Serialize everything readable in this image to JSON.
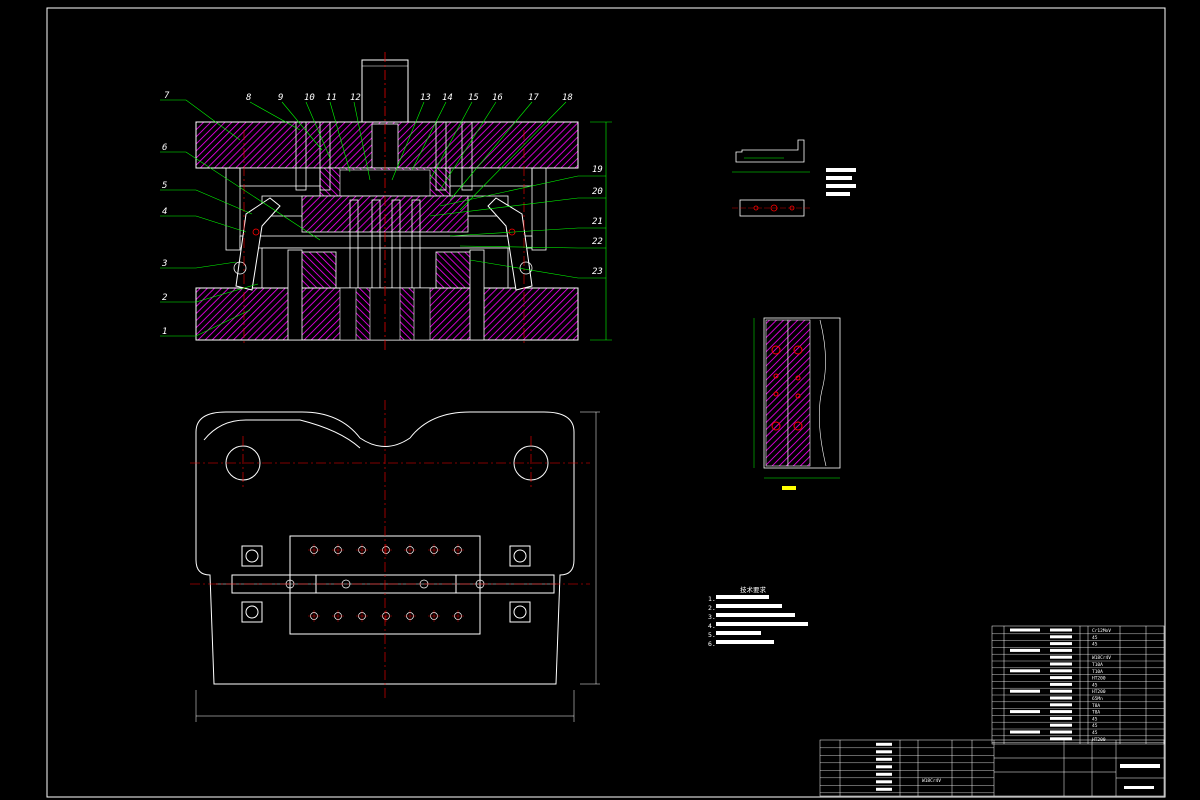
{
  "drawing": {
    "part_numbers": [
      "1",
      "2",
      "3",
      "4",
      "5",
      "6",
      "7",
      "8",
      "9",
      "10",
      "11",
      "12",
      "13",
      "14",
      "15",
      "16",
      "17",
      "18",
      "19",
      "20",
      "21",
      "22",
      "23"
    ],
    "tech_notes": [
      "技术要求",
      "1.",
      "2.",
      "3.",
      "4.",
      "5.",
      "6."
    ],
    "bom_materials": [
      "Cr12MoV",
      "45",
      "45",
      "",
      "W18Cr4V",
      "T10A",
      "T10A",
      "HT200",
      "45",
      "HT200",
      "65Mn",
      "T8A",
      "T8A",
      "45",
      "45",
      "45",
      "HT200"
    ],
    "title_materials": [
      "",
      "",
      "W18Cr4V"
    ],
    "colors": {
      "background": "#000000",
      "outline": "#ffffff",
      "section": "#ff00ff",
      "centerline": "#ff0000",
      "leader": "#00ff00",
      "dimension": "#00ff00",
      "yellow": "#ffff00",
      "cyan": "#00ffff"
    }
  }
}
